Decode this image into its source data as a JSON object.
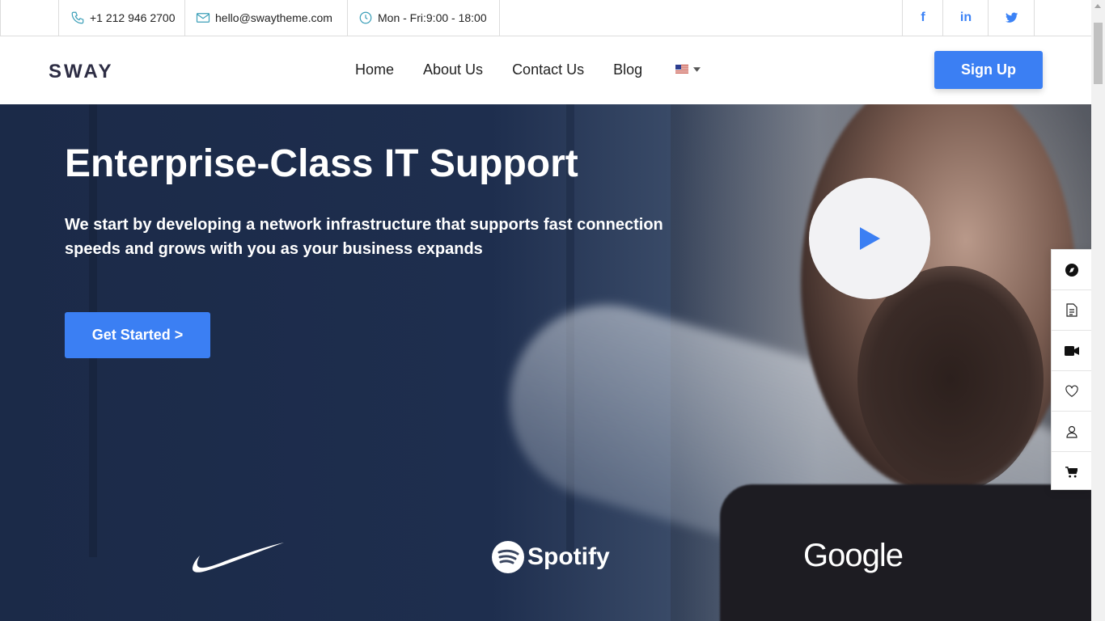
{
  "topbar": {
    "phone": "+1 212 946 2700",
    "email": "hello@swaytheme.com",
    "hours": "Mon - Fri:9:00 - 18:00",
    "social": {
      "facebook": "f",
      "linkedin": "in",
      "twitter": "twitter-icon"
    }
  },
  "nav": {
    "logo": "SWAY",
    "items": [
      "Home",
      "About Us",
      "Contact Us",
      "Blog"
    ],
    "language_icon": "us-flag-icon",
    "signup_label": "Sign Up"
  },
  "hero": {
    "title": "Enterprise-Class IT Support",
    "subtitle": "We start by developing a network infrastructure that supports fast connection speeds and grows with you as your business expands",
    "cta_label": "Get Started >",
    "play_icon": "play-icon"
  },
  "brands": {
    "nike_icon": "nike-swoosh-logo",
    "spotify": "Spotify",
    "google": "Google"
  },
  "sidebar": [
    "compass-icon",
    "document-icon",
    "video-icon",
    "heart-icon",
    "user-icon",
    "cart-icon"
  ],
  "colors": {
    "accent": "#3b7ff3",
    "hero_dark": "#1b2a48",
    "social": "#3b82f6"
  }
}
